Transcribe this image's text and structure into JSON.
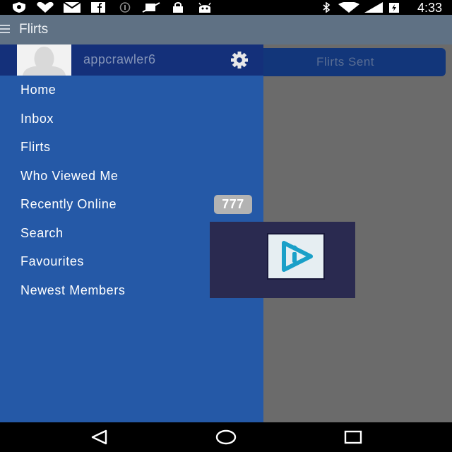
{
  "status_bar": {
    "time": "4:33",
    "icons": [
      "shield-icon",
      "heart-icon",
      "mail-icon",
      "facebook-icon",
      "info-icon",
      "no-sim-icon",
      "lock-icon",
      "android-icon",
      "bluetooth-icon",
      "wifi-icon",
      "battery-charging-icon"
    ]
  },
  "app_bar": {
    "title": "Flirts",
    "menu_icon": "hamburger-icon"
  },
  "content": {
    "tab_label": "Flirts Sent"
  },
  "drawer": {
    "username": "appcrawler6",
    "settings_icon": "gear-icon",
    "items": [
      {
        "label": "Home"
      },
      {
        "label": "Inbox"
      },
      {
        "label": "Flirts"
      },
      {
        "label": "Who Viewed Me"
      },
      {
        "label": "Recently Online",
        "badge": "777"
      },
      {
        "label": "Search"
      },
      {
        "label": "Favourites"
      },
      {
        "label": "Newest Members"
      }
    ]
  },
  "ad": {
    "icon": "play-logo-icon"
  },
  "nav_bar": {
    "buttons": [
      "back-icon",
      "home-icon",
      "recents-icon"
    ]
  },
  "colors": {
    "app_bar": "#5f7184",
    "drawer": "#2559a7",
    "drawer_header": "#14307a",
    "scrim": "#6b6b6b",
    "badge": "#b3b3b3"
  }
}
